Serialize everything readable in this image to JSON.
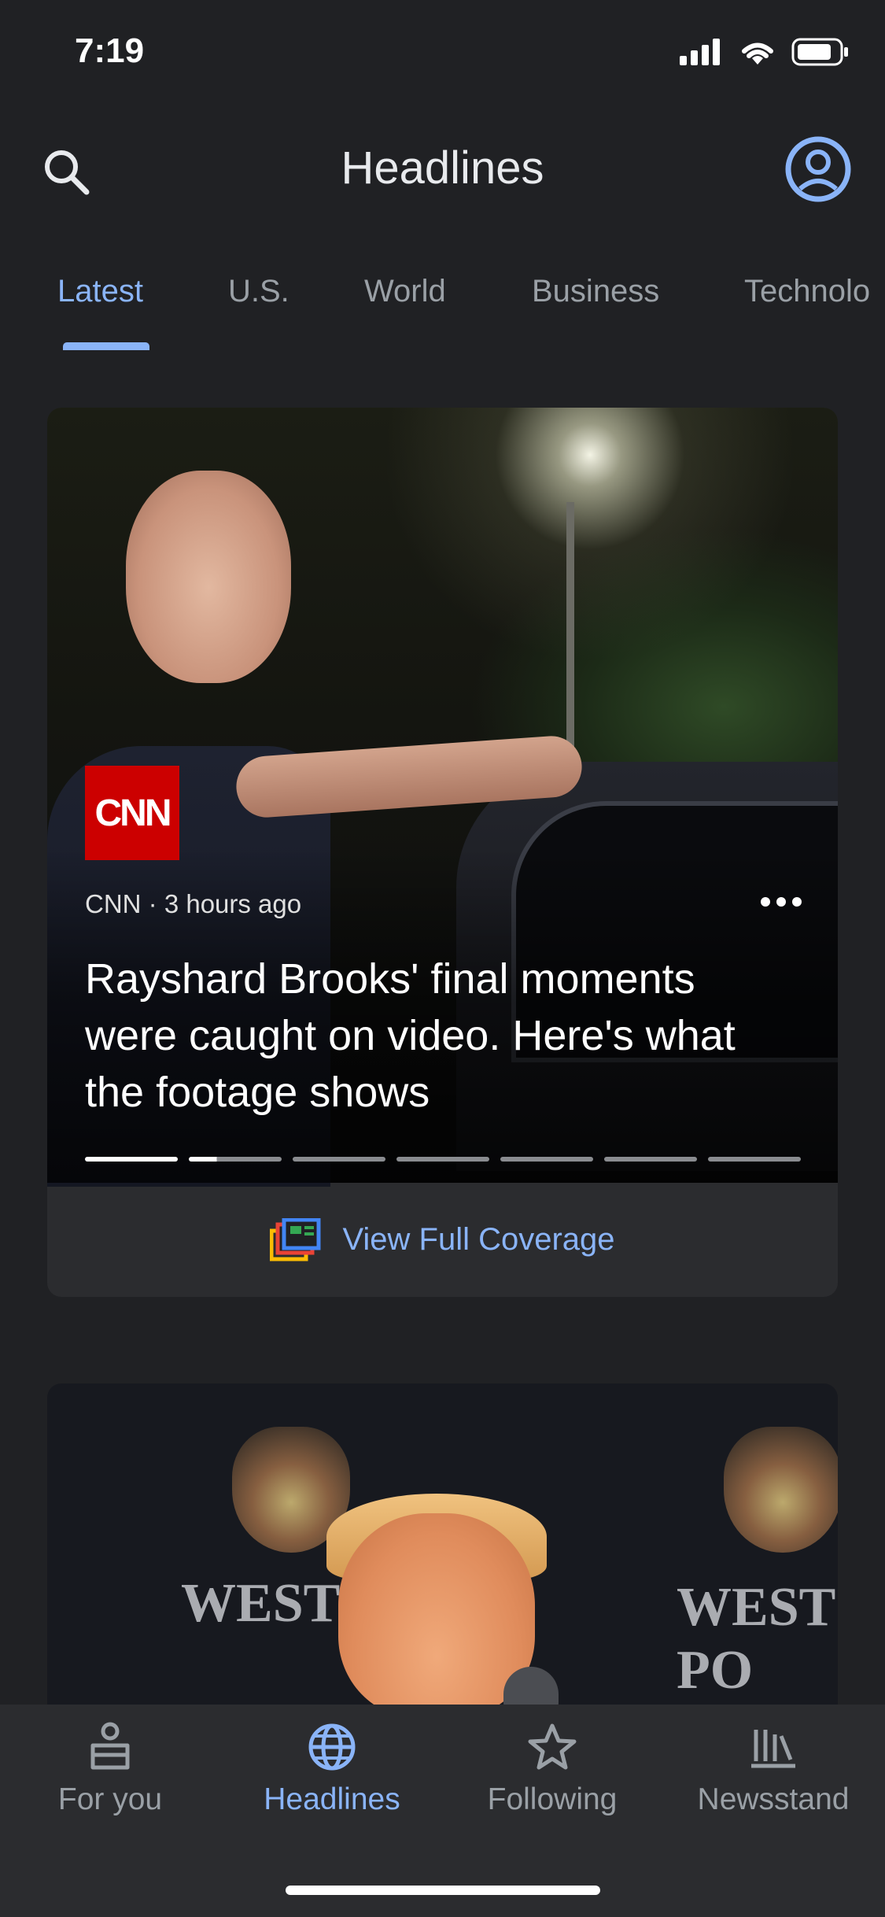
{
  "status_bar": {
    "time": "7:19",
    "icons": [
      "cellular-signal-icon",
      "wifi-icon",
      "battery-icon"
    ]
  },
  "header": {
    "title": "Headlines",
    "search_icon": "search-icon",
    "account_icon": "account-circle-icon"
  },
  "tabs": [
    {
      "label": "Latest",
      "active": true
    },
    {
      "label": "U.S."
    },
    {
      "label": "World"
    },
    {
      "label": "Business"
    },
    {
      "label": "Technolo"
    }
  ],
  "feed": {
    "card1": {
      "source_logo": "CNN",
      "meta": "CNN · 3 hours ago",
      "headline": "Rayshard Brooks' final moments were caught on video. Here's what the footage shows",
      "carousel_segments": 7,
      "carousel_active_index": 1,
      "coverage_label": "View Full Coverage"
    },
    "card2": {
      "background_text": "WEST PO"
    }
  },
  "bottom_nav": [
    {
      "label": "For you",
      "icon": "person-icon"
    },
    {
      "label": "Headlines",
      "icon": "globe-icon",
      "active": true
    },
    {
      "label": "Following",
      "icon": "star-icon"
    },
    {
      "label": "Newsstand",
      "icon": "newsstand-icon"
    }
  ],
  "colors": {
    "background": "#202124",
    "accent": "#8ab4f8",
    "card": "#2b2c2f",
    "muted_text": "#9aa0a6"
  }
}
